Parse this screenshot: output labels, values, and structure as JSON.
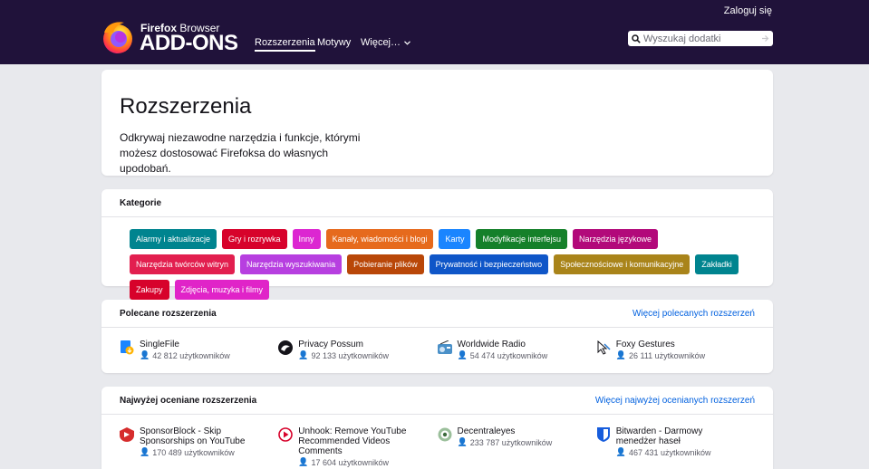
{
  "header": {
    "login": "Zaloguj się",
    "brand_top_bold": "Firefox",
    "brand_top_rest": " Browser",
    "brand_main": "ADD-ONS",
    "nav": [
      "Rozszerzenia",
      "Motywy",
      "Więcej…"
    ],
    "search_placeholder": "Wyszukaj dodatki"
  },
  "hero": {
    "title": "Rozszerzenia",
    "description": "Odkrywaj niezawodne narzędzia i funkcje, którymi możesz dostosować Firefoksa do własnych upodobań."
  },
  "categories": {
    "heading": "Kategorie",
    "items": [
      {
        "label": "Alarmy i aktualizacje",
        "color": "#00848f"
      },
      {
        "label": "Gry i rozrywka",
        "color": "#d7022b"
      },
      {
        "label": "Inny",
        "color": "#dc26d1"
      },
      {
        "label": "Kanały, wiadomości i blogi",
        "color": "#e66a1d"
      },
      {
        "label": "Karty",
        "color": "#1a85ff"
      },
      {
        "label": "Modyfikacje interfejsu",
        "color": "#15802a"
      },
      {
        "label": "Narzędzia językowe",
        "color": "#b2097a"
      },
      {
        "label": "Narzędzia twórców witryn",
        "color": "#e21f4f"
      },
      {
        "label": "Narzędzia wyszukiwania",
        "color": "#b73fe0"
      },
      {
        "label": "Pobieranie plików",
        "color": "#b94708"
      },
      {
        "label": "Prywatność i bezpieczeństwo",
        "color": "#0f56c8"
      },
      {
        "label": "Społecznościowe i komunikacyjne",
        "color": "#a9841a"
      },
      {
        "label": "Zakładki",
        "color": "#00848f"
      },
      {
        "label": "Zakupy",
        "color": "#d7022b"
      },
      {
        "label": "Zdjęcia, muzyka i filmy",
        "color": "#e024c8"
      }
    ]
  },
  "recommended": {
    "heading": "Polecane rozszerzenia",
    "more": "Więcej polecanych rozszerzeń",
    "items": [
      {
        "name": "SingleFile",
        "users": "42 812 użytkowników",
        "icon": "singlefile-icon"
      },
      {
        "name": "Privacy Possum",
        "users": "92 133 użytkowników",
        "icon": "possum-icon"
      },
      {
        "name": "Worldwide Radio",
        "users": "54 474 użytkowników",
        "icon": "radio-icon"
      },
      {
        "name": "Foxy Gestures",
        "users": "26 111 użytkowników",
        "icon": "gesture-icon"
      }
    ]
  },
  "top_rated": {
    "heading": "Najwyżej oceniane rozszerzenia",
    "more": "Więcej najwyżej ocenianych rozszerzeń",
    "items": [
      {
        "name": "SponsorBlock - Skip Sponsorships on YouTube",
        "users": "170 489 użytkowników",
        "icon": "sponsorblock-icon"
      },
      {
        "name": "Unhook: Remove YouTube Recommended Videos Comments",
        "users": "17 604 użytkowników",
        "icon": "unhook-icon"
      },
      {
        "name": "Decentraleyes",
        "users": "233 787 użytkowników",
        "icon": "decentraleyes-icon"
      },
      {
        "name": "Bitwarden - Darmowy menedżer haseł",
        "users": "467 431 użytkowników",
        "icon": "bitwarden-icon"
      }
    ]
  }
}
